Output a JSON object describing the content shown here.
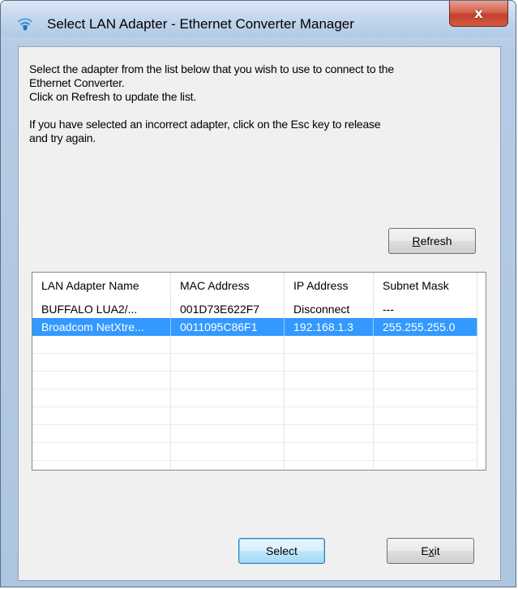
{
  "window": {
    "title": "Select LAN Adapter - Ethernet Converter Manager",
    "close_label": "x",
    "icon": "wifi-icon"
  },
  "instructions": {
    "line1": "Select the adapter from the list below that you wish to use to connect to the",
    "line2": "Ethernet Converter.",
    "line3": "Click on Refresh to update the list.",
    "line4": "If you have selected an incorrect adapter, click on the Esc key to release",
    "line5": "and try again."
  },
  "buttons": {
    "refresh": {
      "pre": "",
      "mnemonic": "R",
      "post": "efresh"
    },
    "select": "Select",
    "exit": {
      "pre": "E",
      "mnemonic": "x",
      "post": "it"
    }
  },
  "adapter_list": {
    "columns": [
      "LAN Adapter Name",
      "MAC Address",
      "IP Address",
      "Subnet Mask"
    ],
    "rows": [
      {
        "name": "BUFFALO LUA2/...",
        "mac": "001D73E622F7",
        "ip": "Disconnect",
        "mask": "---",
        "selected": false
      },
      {
        "name": "Broadcom NetXtre...",
        "mac": "0011095C86F1",
        "ip": "192.168.1.3",
        "mask": "255.255.255.0",
        "selected": true
      }
    ]
  },
  "colors": {
    "selection": "#3399ff",
    "close_button": "#c2402c",
    "frame": "#b6cbe4"
  }
}
